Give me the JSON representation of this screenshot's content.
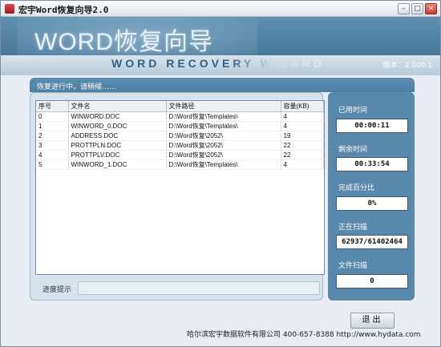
{
  "window": {
    "title": "宏宇Word恢复向导2.0",
    "controls": {
      "minimize": "–",
      "maximize": "□",
      "close": "×"
    }
  },
  "banner": {
    "title": "WORD恢复向导",
    "subtitle": "WORD RECOVERY WIZARD",
    "version": "版本：2.000.1"
  },
  "status": {
    "text": "恢复进行中，请稍候……"
  },
  "table": {
    "headers": [
      "序号",
      "文件名",
      "文件路径",
      "容量(KB)"
    ],
    "rows": [
      [
        "0",
        "WINWORD.DOC",
        "D:\\Word恢复\\Templates\\",
        "4"
      ],
      [
        "1",
        "WINWORD_0.DOC",
        "D:\\Word恢复\\Templates\\",
        "4"
      ],
      [
        "2",
        "ADDRESS.DOC",
        "D:\\Word恢复\\2052\\",
        "19"
      ],
      [
        "3",
        "PROTTPLN.DOC",
        "D:\\Word恢复\\2052\\",
        "22"
      ],
      [
        "4",
        "PROTTPLV.DOC",
        "D:\\Word恢复\\2052\\",
        "22"
      ],
      [
        "5",
        "WINWORD_1.DOC",
        "D:\\Word恢复\\Templates\\",
        "4"
      ]
    ]
  },
  "progress": {
    "label": "进度提示",
    "value": ""
  },
  "side": {
    "elapsed_label": "已用时间",
    "elapsed_value": "00:00:11",
    "remaining_label": "剩余时间",
    "remaining_value": "00:33:54",
    "percent_label": "完成百分比",
    "percent_value": "0%",
    "scanning_label": "正在扫描",
    "scanning_value": "62937/61402464",
    "files_label": "文件扫描",
    "files_value": "0"
  },
  "buttons": {
    "exit": "退出"
  },
  "footer": {
    "text": "哈尔滨宏宇数据软件有限公司  400-657-8388  http://www.hydata.com"
  },
  "colors": {
    "banner": "#4f7fa3",
    "panel": "#5888ab",
    "background": "#e8edf3"
  }
}
